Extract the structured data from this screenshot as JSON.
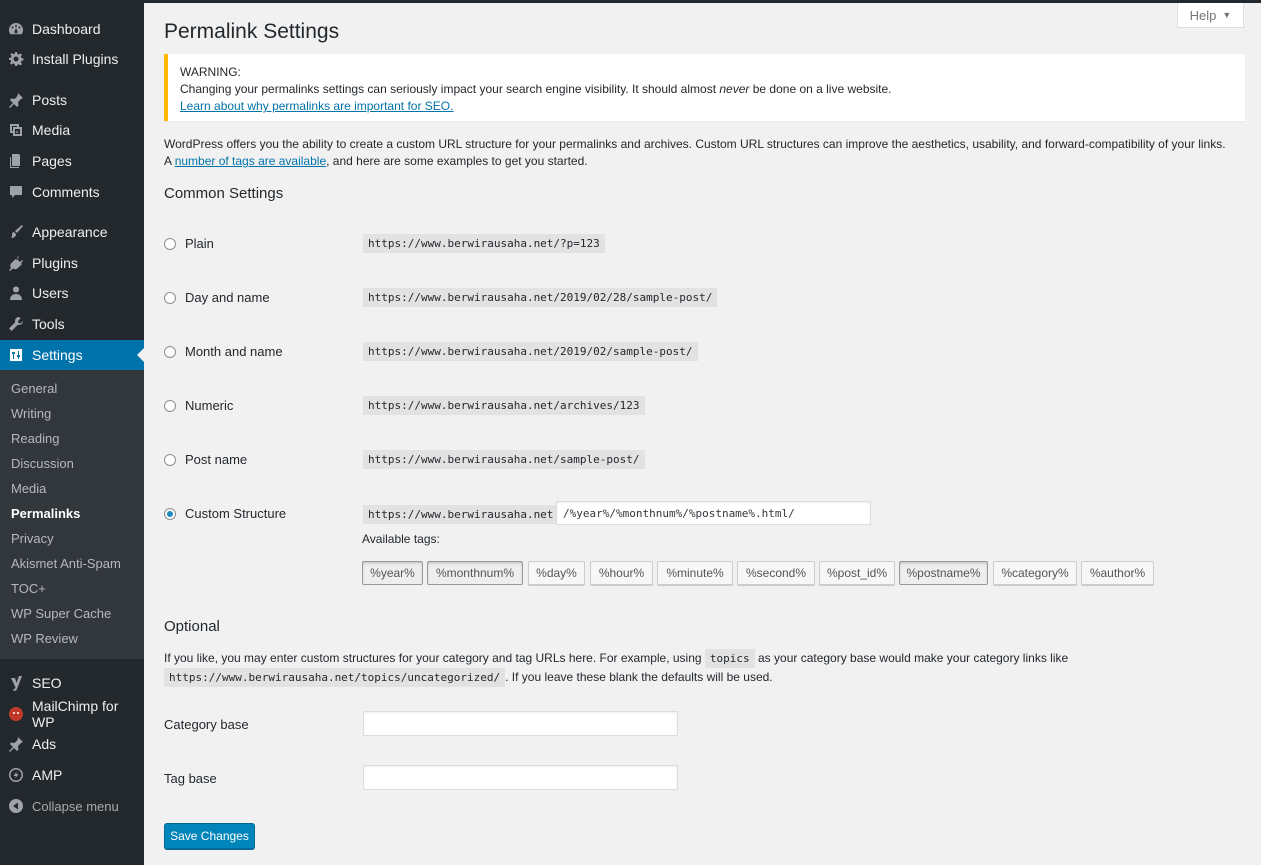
{
  "sidebar": {
    "items": [
      {
        "label": "Dashboard",
        "icon": "dashboard-icon"
      },
      {
        "label": "Install Plugins",
        "icon": "gear-icon"
      },
      {
        "label": "Posts",
        "icon": "pushpin-icon"
      },
      {
        "label": "Media",
        "icon": "media-icon"
      },
      {
        "label": "Pages",
        "icon": "pages-icon"
      },
      {
        "label": "Comments",
        "icon": "comment-icon"
      },
      {
        "label": "Appearance",
        "icon": "brush-icon"
      },
      {
        "label": "Plugins",
        "icon": "plugin-icon"
      },
      {
        "label": "Users",
        "icon": "user-icon"
      },
      {
        "label": "Tools",
        "icon": "wrench-icon"
      },
      {
        "label": "Settings",
        "icon": "settings-icon"
      },
      {
        "label": "SEO",
        "icon": "yoast-icon"
      },
      {
        "label": "MailChimp for WP",
        "icon": "mailchimp-icon"
      },
      {
        "label": "Ads",
        "icon": "pushpin-icon"
      },
      {
        "label": "AMP",
        "icon": "amp-icon"
      }
    ],
    "submenu": [
      "General",
      "Writing",
      "Reading",
      "Discussion",
      "Media",
      "Permalinks",
      "Privacy",
      "Akismet Anti-Spam",
      "TOC+",
      "WP Super Cache",
      "WP Review"
    ],
    "collapse_label": "Collapse menu",
    "active_color": "#0073aa"
  },
  "help_label": "Help",
  "page_title": "Permalink Settings",
  "warning": {
    "title": "WARNING:",
    "text_before": "Changing your permalinks settings can seriously impact your search engine visibility. It should almost ",
    "text_em": "never",
    "text_after": " be done on a live website.",
    "link": "Learn about why permalinks are important for SEO.",
    "border_color": "#ffb900"
  },
  "intro": {
    "text": "WordPress offers you the ability to create a custom URL structure for your permalinks and archives. Custom URL structures can improve the aesthetics, usability, and forward-compatibility of your links. A ",
    "link": "number of tags are available",
    "text_after": ", and here are some examples to get you started."
  },
  "common_settings_title": "Common Settings",
  "options": [
    {
      "label": "Plain",
      "url": "https://www.berwirausaha.net/?p=123",
      "checked": false
    },
    {
      "label": "Day and name",
      "url": "https://www.berwirausaha.net/2019/02/28/sample-post/",
      "checked": false
    },
    {
      "label": "Month and name",
      "url": "https://www.berwirausaha.net/2019/02/sample-post/",
      "checked": false
    },
    {
      "label": "Numeric",
      "url": "https://www.berwirausaha.net/archives/123",
      "checked": false
    },
    {
      "label": "Post name",
      "url": "https://www.berwirausaha.net/sample-post/",
      "checked": false
    },
    {
      "label": "Custom Structure",
      "url": "https://www.berwirausaha.net",
      "checked": true
    }
  ],
  "custom_structure_value": "/%year%/%monthnum%/%postname%.html/",
  "available_tags_label": "Available tags:",
  "tags": [
    {
      "label": "%year%",
      "pressed": true
    },
    {
      "label": "%monthnum%",
      "pressed": true
    },
    {
      "label": "%day%",
      "pressed": false
    },
    {
      "label": "%hour%",
      "pressed": false
    },
    {
      "label": "%minute%",
      "pressed": false
    },
    {
      "label": "%second%",
      "pressed": false
    },
    {
      "label": "%post_id%",
      "pressed": false
    },
    {
      "label": "%postname%",
      "pressed": true
    },
    {
      "label": "%category%",
      "pressed": false
    },
    {
      "label": "%author%",
      "pressed": false
    }
  ],
  "optional": {
    "title": "Optional",
    "text1": "If you like, you may enter custom structures for your category and tag URLs here. For example, using ",
    "code1": "topics",
    "text2": " as your category base would make your category links like",
    "code2": "https://www.berwirausaha.net/topics/uncategorized/",
    "text3": ". If you leave these blank the defaults will be used.",
    "category_base_label": "Category base",
    "category_base_value": "",
    "tag_base_label": "Tag base",
    "tag_base_value": ""
  },
  "save_label": "Save Changes"
}
